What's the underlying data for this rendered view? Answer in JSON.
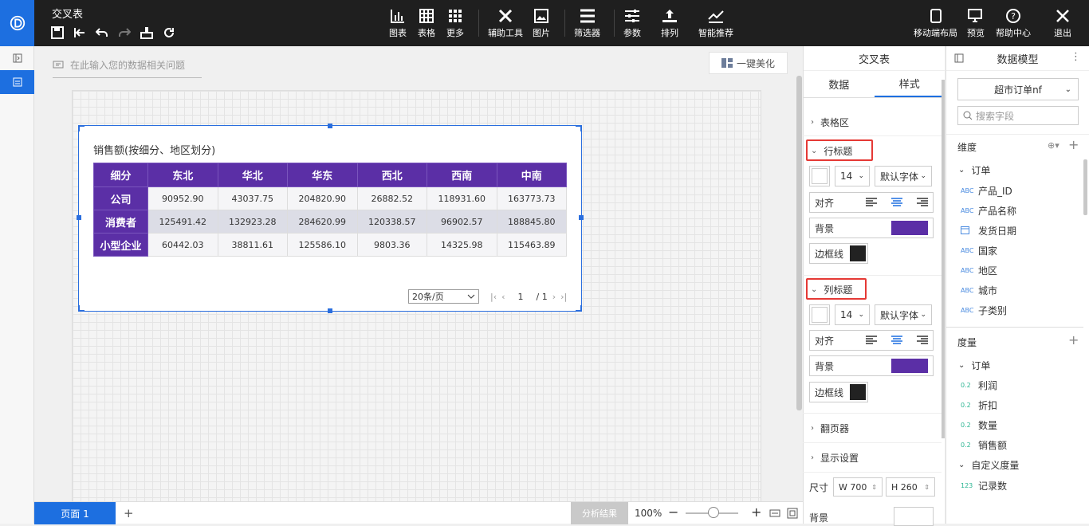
{
  "topbar": {
    "title": "交叉表",
    "tools": [
      {
        "id": "chart",
        "label": "图表"
      },
      {
        "id": "table",
        "label": "表格"
      },
      {
        "id": "more",
        "label": "更多"
      },
      {
        "id": "aux",
        "label": "辅助工具"
      },
      {
        "id": "image",
        "label": "图片"
      },
      {
        "id": "filter",
        "label": "筛选器"
      },
      {
        "id": "param",
        "label": "参数"
      },
      {
        "id": "arrange",
        "label": "排列"
      },
      {
        "id": "smart",
        "label": "智能推荐"
      }
    ],
    "right_tools": [
      {
        "id": "mobile",
        "label": "移动端布局"
      },
      {
        "id": "preview",
        "label": "预览"
      },
      {
        "id": "help",
        "label": "帮助中心"
      },
      {
        "id": "exit",
        "label": "退出"
      }
    ]
  },
  "canvas": {
    "ask_placeholder": "在此输入您的数据相关问题",
    "beautify_label": "一键美化"
  },
  "widget": {
    "title": "销售额(按细分、地区划分)",
    "corner_header": "细分",
    "columns": [
      "东北",
      "华北",
      "华东",
      "西北",
      "西南",
      "中南"
    ],
    "rows": [
      {
        "label": "公司",
        "values": [
          "90952.90",
          "43037.75",
          "204820.90",
          "26882.52",
          "118931.60",
          "163773.73"
        ]
      },
      {
        "label": "消费者",
        "values": [
          "125491.42",
          "132923.28",
          "284620.99",
          "120338.57",
          "96902.57",
          "188845.80"
        ]
      },
      {
        "label": "小型企业",
        "values": [
          "60442.03",
          "38811.61",
          "125586.10",
          "9803.36",
          "14325.98",
          "115463.89"
        ]
      }
    ],
    "pager": {
      "page_size": "20条/页",
      "current": "1",
      "total": "/ 1"
    }
  },
  "bottombar": {
    "page_tab": "页面 1",
    "add": "+",
    "analysis": "分析结果",
    "zoom": "100%",
    "minus": "−",
    "plus": "+"
  },
  "mid_panel": {
    "title": "交叉表",
    "tabs": [
      "数据",
      "样式"
    ],
    "sections": {
      "table_area": "表格区",
      "row_header": "行标题",
      "col_header": "列标题",
      "pager": "翻页器",
      "display": "显示设置"
    },
    "font_size": "14",
    "font_family": "默认字体",
    "align_label": "对齐",
    "bg_label": "背景",
    "border_label": "边框线",
    "size_label": "尺寸",
    "width": "W 700",
    "height": "H 260",
    "bottom_bg": "背景",
    "header_bg_color": "#5b2fa6"
  },
  "right_panel": {
    "title": "数据模型",
    "dataset": "超市订单nf",
    "search_placeholder": "搜索字段",
    "dim_title": "维度",
    "dim_group": "订单",
    "dimensions": [
      "产品_ID",
      "产品名称",
      "发货日期",
      "国家",
      "地区",
      "城市",
      "子类别"
    ],
    "measure_title": "度量",
    "measure_group": "订单",
    "measures": [
      "利润",
      "折扣",
      "数量",
      "销售额"
    ],
    "custom_group": "自定义度量",
    "custom_measures": [
      "记录数"
    ],
    "measure_tag": "0.2",
    "custom_tag": "123",
    "dim_tag": "ABC"
  }
}
